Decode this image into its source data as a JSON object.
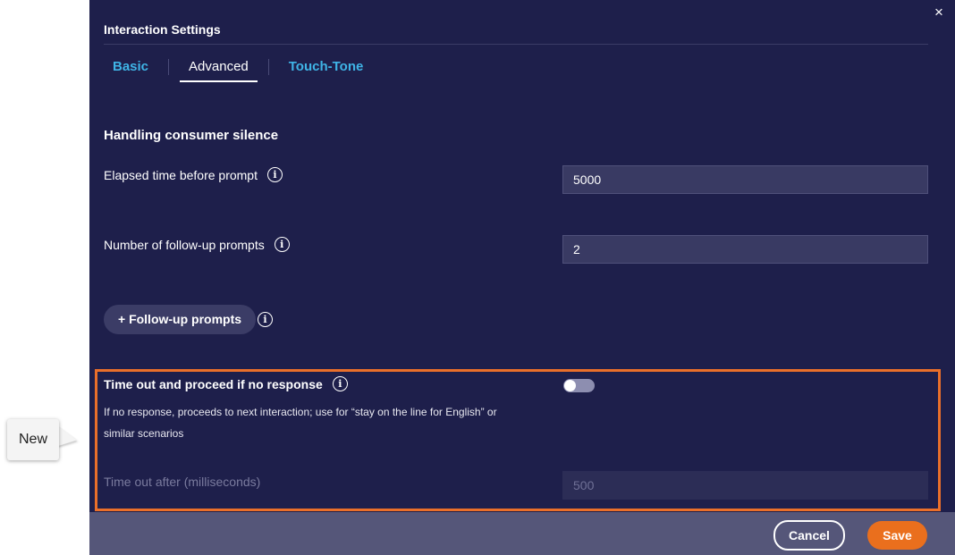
{
  "callout": {
    "label": "New"
  },
  "dialog": {
    "title": "Interaction Settings",
    "close_icon": "×",
    "tabs": [
      {
        "label": "Basic",
        "active": false
      },
      {
        "label": "Advanced",
        "active": true
      },
      {
        "label": "Touch-Tone",
        "active": false
      }
    ]
  },
  "silence": {
    "section_title": "Handling consumer silence",
    "elapsed_label": "Elapsed time before prompt",
    "elapsed_value": "5000",
    "followup_count_label": "Number of follow-up prompts",
    "followup_count_value": "2",
    "add_followup_label": "+ Follow-up prompts",
    "info_glyph": "i"
  },
  "timeout": {
    "label": "Time out and proceed if no response",
    "description": "If no response, proceeds to next interaction; use for “stay on the line for English” or similar scenarios",
    "toggle_on": false,
    "after_label": "Time out after (milliseconds)",
    "after_value": "500"
  },
  "footer": {
    "cancel_label": "Cancel",
    "save_label": "Save"
  },
  "colors": {
    "panel_bg": "#1e1f4b",
    "accent_tab": "#3fb4e6",
    "highlight": "#ea6f2a",
    "save": "#ea6f1d",
    "footer_bg": "#555679"
  }
}
